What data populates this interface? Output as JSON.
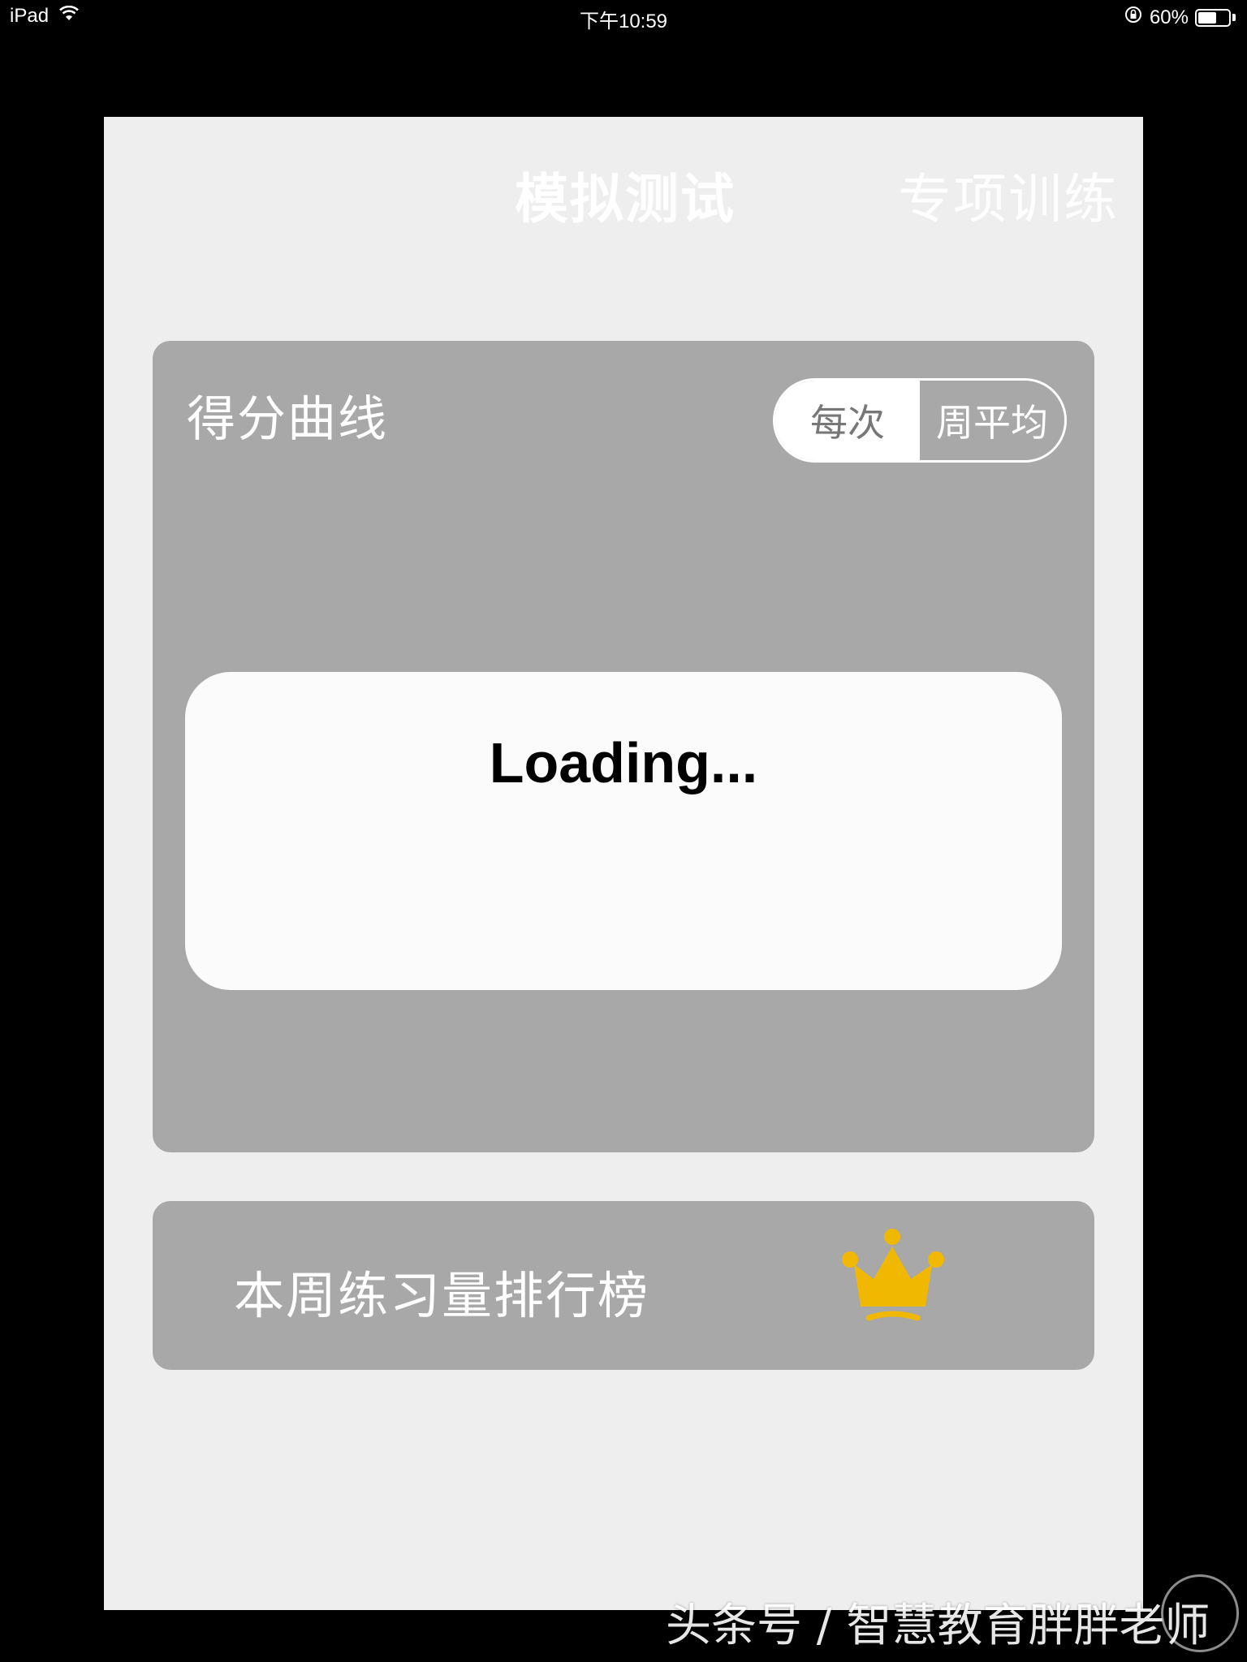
{
  "status_bar": {
    "device": "iPad",
    "time": "下午10:59",
    "battery_text": "60%",
    "battery_level": 0.6,
    "icons": [
      "wifi-icon",
      "orientation-lock-icon",
      "battery-icon"
    ]
  },
  "tabs": {
    "mock_test": "模拟测试",
    "special_training": "专项训练",
    "active": "mock_test"
  },
  "score_card": {
    "title": "得分曲线",
    "toggle": {
      "each_label": "每次",
      "weekly_label": "周平均",
      "selected": "weekly"
    },
    "loading_text": "Loading..."
  },
  "ranking_card": {
    "title": "本周练习量排行榜",
    "icon": "crown-icon",
    "icon_color": "#f0b800"
  },
  "watermark": {
    "text": "头条号 / 智慧教育胖胖老师"
  },
  "colors": {
    "screen_bg": "#000000",
    "app_bg": "#eeeeee",
    "card_bg": "#a8a8a8",
    "accent_crown": "#f0b800",
    "loading_bg": "#fbfbfb"
  }
}
